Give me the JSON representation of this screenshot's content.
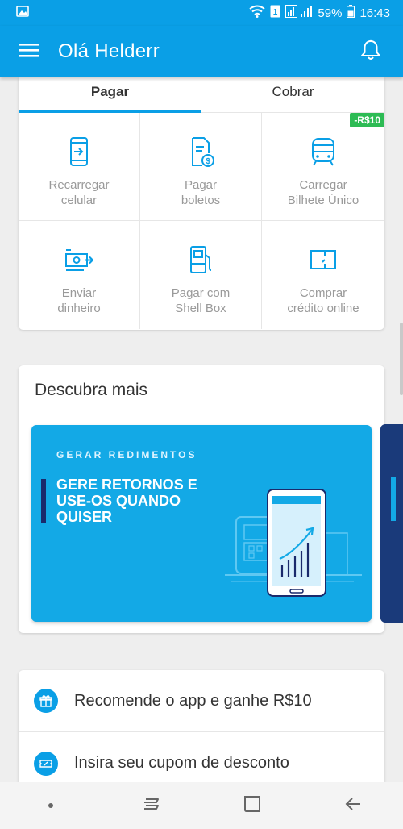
{
  "status_bar": {
    "battery": "59%",
    "time": "16:43",
    "icons": [
      "image-icon",
      "wifi-icon",
      "sim-icon",
      "signal-icon",
      "battery-icon"
    ]
  },
  "app_bar": {
    "title": "Olá Helderr",
    "icons": [
      "menu-icon",
      "bell-icon"
    ]
  },
  "pay_card": {
    "tabs": [
      {
        "label": "Pagar",
        "active": true
      },
      {
        "label": "Cobrar",
        "active": false
      }
    ],
    "actions": [
      {
        "label": "Recarregar\ncelular",
        "icon": "phone-recharge-icon"
      },
      {
        "label": "Pagar\nboletos",
        "icon": "bill-icon"
      },
      {
        "label": "Carregar\nBilhete Único",
        "icon": "bus-icon",
        "badge": "-R$10"
      },
      {
        "label": "Enviar\ndinheiro",
        "icon": "send-money-icon"
      },
      {
        "label": "Pagar com\nShell Box",
        "icon": "fuel-pump-icon"
      },
      {
        "label": "Comprar\ncrédito online",
        "icon": "ticket-icon"
      }
    ]
  },
  "discover": {
    "title": "Descubra mais",
    "banner": {
      "eyebrow": "GERAR REDIMENTOS",
      "headline": "GERE RETORNOS E\nUSE-OS QUANDO\nQUISER"
    }
  },
  "links": [
    {
      "label": "Recomende o app e ganhe R$10",
      "icon": "gift-icon"
    },
    {
      "label": "Insira seu cupom de desconto",
      "icon": "coupon-icon"
    }
  ],
  "colors": {
    "primary": "#0a9fe6",
    "banner": "#13a9e6",
    "badge": "#2dbb54",
    "navy": "#1a2a6c"
  }
}
